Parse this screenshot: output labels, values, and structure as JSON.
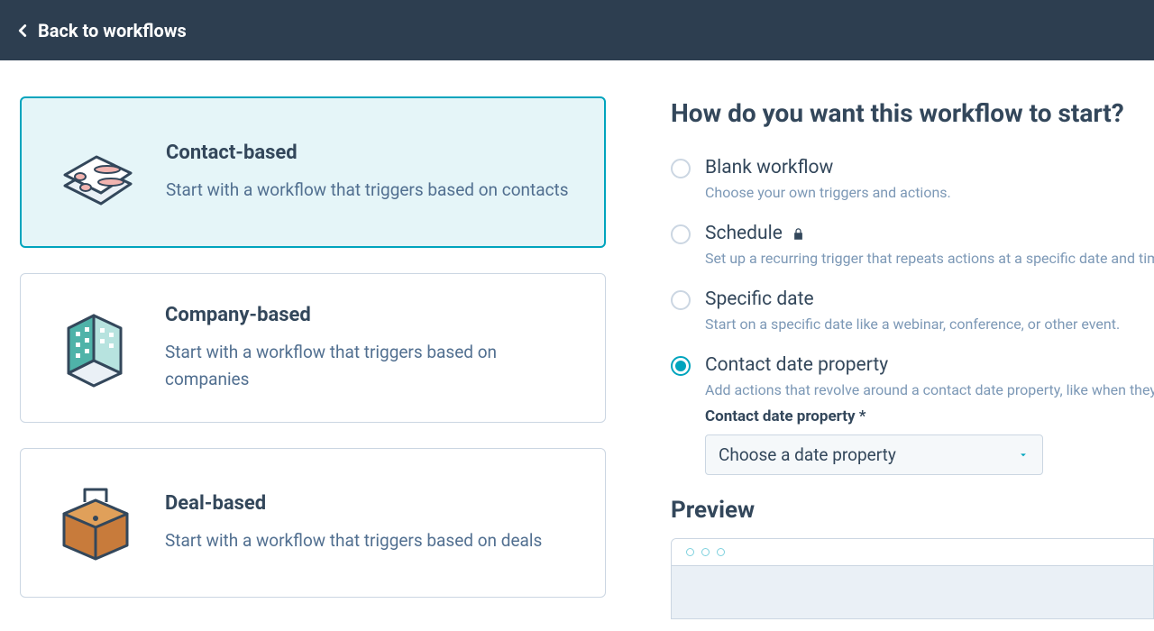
{
  "topbar": {
    "back_label": "Back to workflows"
  },
  "cards": [
    {
      "title": "Contact-based",
      "desc": "Start with a workflow that triggers based on contacts",
      "selected": true,
      "icon": "contact"
    },
    {
      "title": "Company-based",
      "desc": "Start with a workflow that triggers based on companies",
      "selected": false,
      "icon": "company"
    },
    {
      "title": "Deal-based",
      "desc": "Start with a workflow that triggers based on deals",
      "selected": false,
      "icon": "deal"
    }
  ],
  "right": {
    "title": "How do you want this workflow to start?",
    "options": [
      {
        "title": "Blank workflow",
        "desc": "Choose your own triggers and actions.",
        "locked": false,
        "selected": false
      },
      {
        "title": "Schedule",
        "desc": "Set up a recurring trigger that repeats actions at a specific date and time.",
        "locked": true,
        "selected": false
      },
      {
        "title": "Specific date",
        "desc": "Start on a specific date like a webinar, conference, or other event.",
        "locked": false,
        "selected": false
      },
      {
        "title": "Contact date property",
        "desc": "Add actions that revolve around a contact date property, like when they became a customer.",
        "locked": false,
        "selected": true
      }
    ],
    "date_property": {
      "label": "Contact date property *",
      "placeholder": "Choose a date property"
    },
    "preview_title": "Preview"
  }
}
